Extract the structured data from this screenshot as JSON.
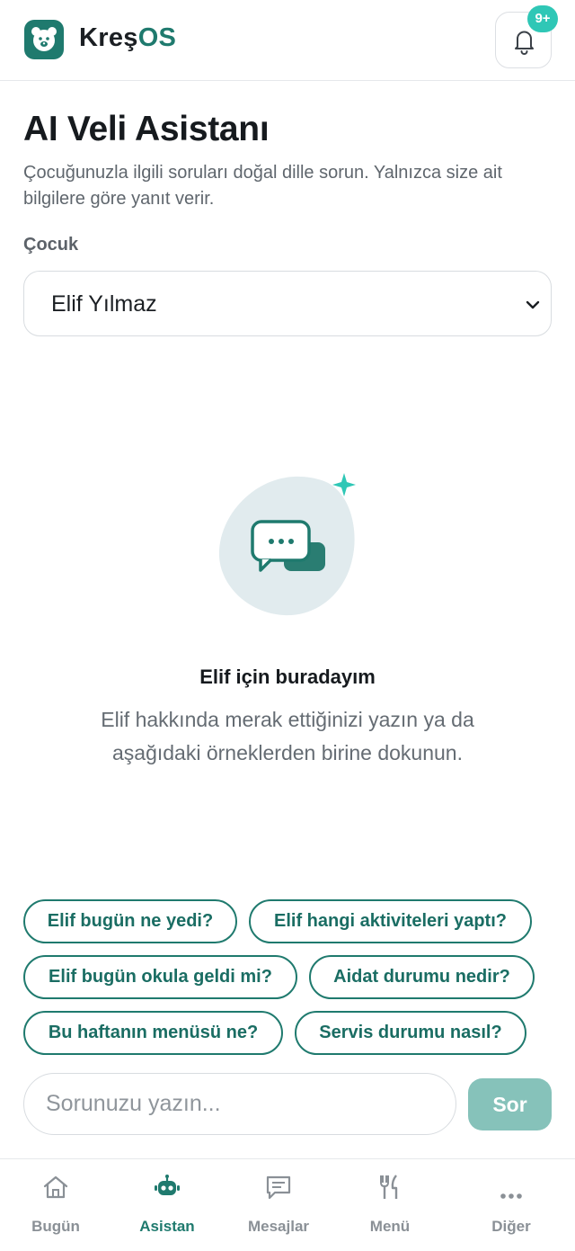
{
  "header": {
    "brand_part1": "Kreş",
    "brand_part2": "OS",
    "notification_badge": "9+"
  },
  "page": {
    "title": "AI Veli Asistanı",
    "subtitle": "Çocuğunuzla ilgili soruları doğal dille sorun. Yalnızca size ait bilgilere göre yanıt verir.",
    "child_label": "Çocuk",
    "child_selected": "Elif Yılmaz"
  },
  "empty_state": {
    "title": "Elif için buradayım",
    "description": "Elif hakkında merak ettiğinizi yazın ya da aşağıdaki örneklerden birine dokunun."
  },
  "suggestions": [
    "Elif bugün ne yedi?",
    "Elif hangi aktiviteleri yaptı?",
    "Elif bugün okula geldi mi?",
    "Aidat durumu nedir?",
    "Bu haftanın menüsü ne?",
    "Servis durumu nasıl?"
  ],
  "composer": {
    "placeholder": "Sorunuzu yazın...",
    "send_label": "Sor"
  },
  "bottom_nav": [
    {
      "label": "Bugün",
      "icon": "home-icon",
      "active": false
    },
    {
      "label": "Asistan",
      "icon": "robot-icon",
      "active": true
    },
    {
      "label": "Mesajlar",
      "icon": "message-icon",
      "active": false
    },
    {
      "label": "Menü",
      "icon": "fork-knife-icon",
      "active": false
    },
    {
      "label": "Diğer",
      "icon": "more-dots-icon",
      "active": false
    }
  ],
  "colors": {
    "brand": "#1f7a6e",
    "badge": "#2fc7b6",
    "send_button_disabled": "#86c2ba"
  }
}
